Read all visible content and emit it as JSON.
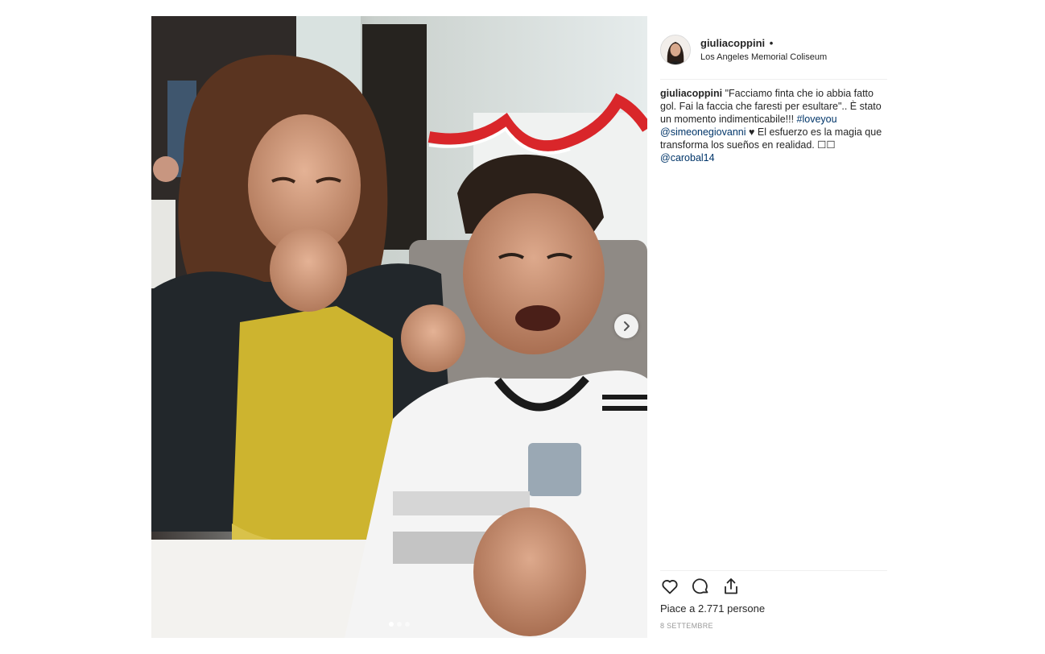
{
  "post": {
    "username": "giuliacoppini",
    "separator": "•",
    "location": "Los Angeles Memorial Coliseum",
    "caption": {
      "username": "giuliacoppini",
      "text_part1": "\"Facciamo finta che io abbia fatto gol. Fai la faccia che faresti per esultare\".. È stato un momento indimenticabile!!!",
      "hashtag": "#loveyou",
      "mention1": "@simeonegiovanni",
      "text_part2": "♥ El esfuerzo es la magia que transforma los sueños en realidad. ☐☐",
      "mention2": "@carobal14"
    },
    "likes": "Piace a 2.771 persone",
    "date": "8 SETTEMBRE",
    "carousel": {
      "slides": 3,
      "active_index": 0
    }
  },
  "icons": {
    "next": "chevron-right-icon",
    "like": "heart-icon",
    "comment": "comment-icon",
    "share": "share-icon"
  },
  "colors": {
    "text": "#262626",
    "link": "#003569",
    "muted": "#999999",
    "divider": "#efefef"
  }
}
